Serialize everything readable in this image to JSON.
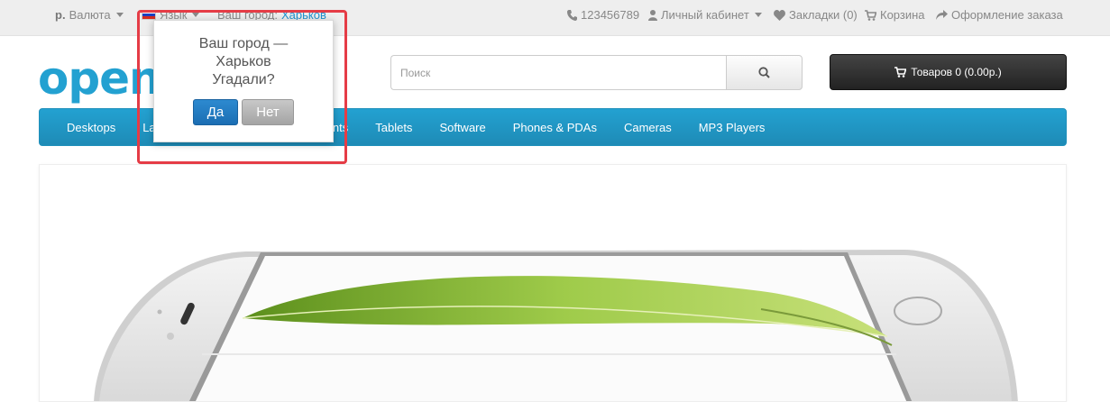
{
  "topbar": {
    "currency_symbol": "р.",
    "currency_label": "Валюта",
    "language_label": "Язык",
    "city_prefix": "Ваш город:",
    "city_name": "Харьков",
    "phone": "123456789",
    "account": "Личный кабинет",
    "wishlist": "Закладки (0)",
    "cart": "Корзина",
    "checkout": "Оформление заказа"
  },
  "header": {
    "logo_text": "openc",
    "search_placeholder": "Поиск",
    "cart_button": "Товаров 0 (0.00р.)"
  },
  "menu": {
    "items": [
      "Desktops",
      "Laptops & Notebooks",
      "Components",
      "Tablets",
      "Software",
      "Phones & PDAs",
      "Cameras",
      "MP3 Players"
    ]
  },
  "popup": {
    "line1": "Ваш город —",
    "line2": "Харьков",
    "line3": "Угадали?",
    "yes": "Да",
    "no": "Нет"
  },
  "colors": {
    "brand": "#23a1d1",
    "highlight": "#e53c46",
    "yes_button": "#1b6eb3"
  },
  "icons": [
    "caret-down-icon",
    "flag-ru-icon",
    "phone-icon",
    "user-icon",
    "heart-icon",
    "cart-icon",
    "share-icon",
    "search-icon"
  ]
}
